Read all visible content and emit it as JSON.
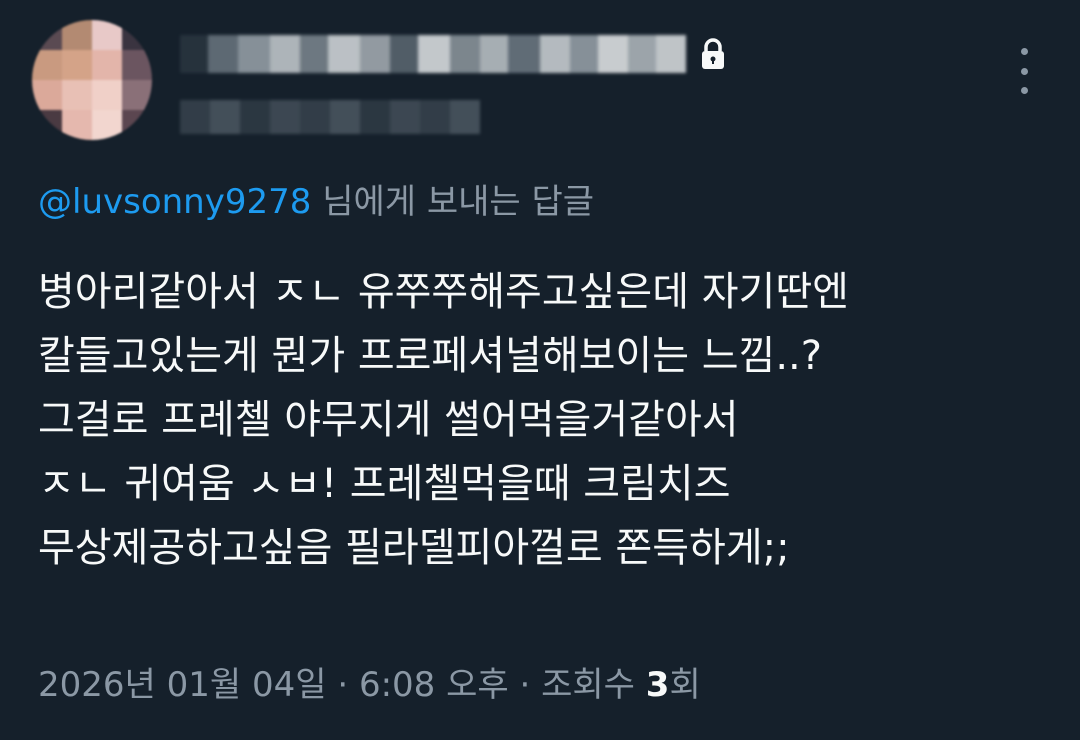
{
  "colors": {
    "background": "#15202b",
    "text_primary": "#f7f9f9",
    "text_secondary": "#8b98a5",
    "accent": "#1d9bf0"
  },
  "header": {
    "avatar_icon": "pixelated-avatar",
    "lock_icon": "lock-icon",
    "more_icon": "more-vertical-icon"
  },
  "reply": {
    "mention": "@luvsonny9278",
    "suffix": " 님에게 보내는 답글"
  },
  "tweet": {
    "lines": [
      "병아리같아서 ㅈㄴ 유쭈쭈해주고싶은데 자기딴엔",
      "칼들고있는게 뭔가 프로페셔널해보이는 느낌..?",
      "그걸로 프레첼 야무지게 썰어먹을거같아서",
      "ㅈㄴ 귀여움 ㅅㅂ! 프레첼먹을때 크림치즈",
      "무상제공하고싶음 필라델피아껄로 쫀득하게;;"
    ]
  },
  "meta": {
    "date": "2026년 01월 04일",
    "sep1": " · ",
    "time": "6:08 오후",
    "sep2": " · ",
    "views_label": "조회수 ",
    "views_count": "3",
    "views_suffix": "회"
  }
}
